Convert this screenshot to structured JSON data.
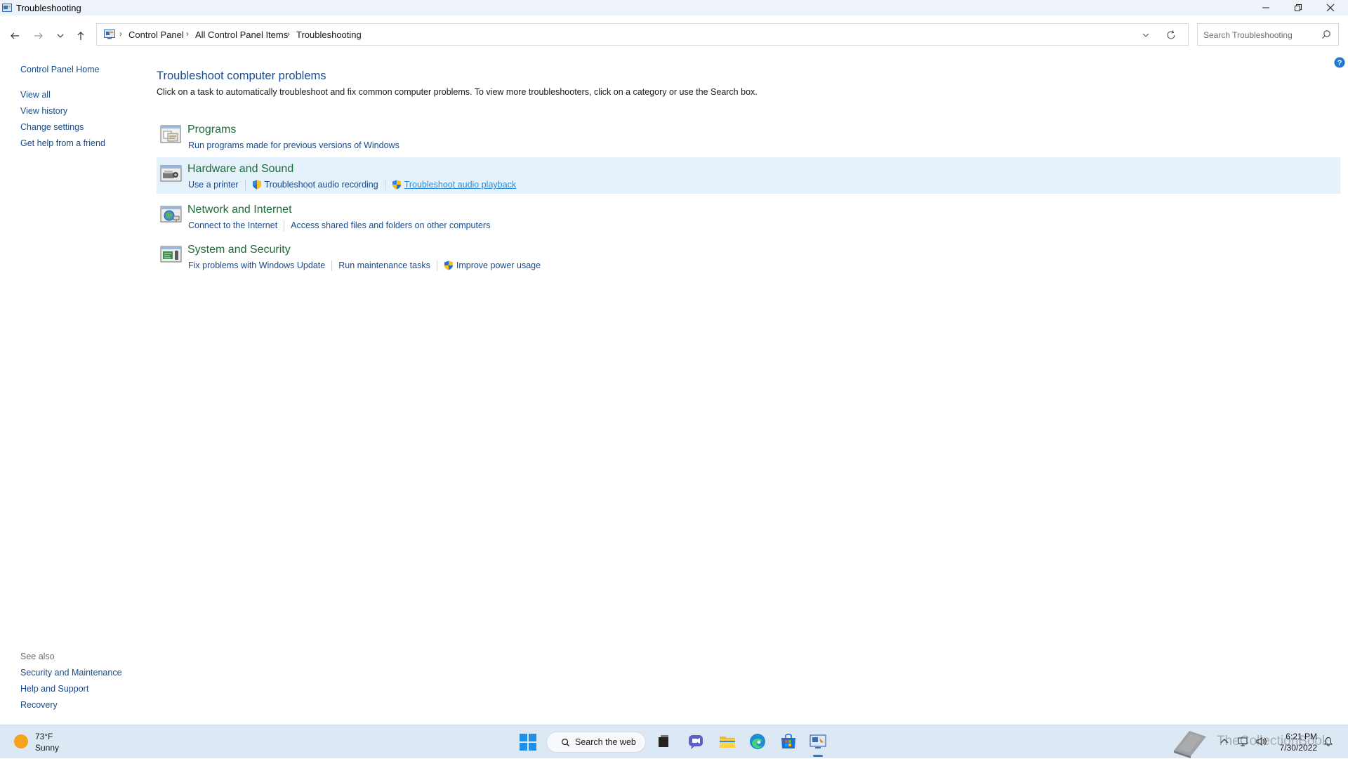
{
  "window": {
    "title": "Troubleshooting"
  },
  "breadcrumb": [
    "Control Panel",
    "All Control Panel Items",
    "Troubleshooting"
  ],
  "search": {
    "placeholder": "Search Troubleshooting"
  },
  "sidebar": {
    "home": "Control Panel Home",
    "items": [
      "View all",
      "View history",
      "Change settings",
      "Get help from a friend"
    ],
    "see_also_label": "See also",
    "see_also": [
      "Security and Maintenance",
      "Help and Support",
      "Recovery"
    ]
  },
  "main": {
    "title": "Troubleshoot computer problems",
    "description": "Click on a task to automatically troubleshoot and fix common computer problems. To view more troubleshooters, click on a category or use the Search box.",
    "categories": [
      {
        "title": "Programs",
        "icon": "programs-icon",
        "links": [
          {
            "label": "Run programs made for previous versions of Windows",
            "shield": false
          }
        ]
      },
      {
        "title": "Hardware and Sound",
        "icon": "hardware-sound-icon",
        "links": [
          {
            "label": "Use a printer",
            "shield": false
          },
          {
            "label": "Troubleshoot audio recording",
            "shield": true
          },
          {
            "label": "Troubleshoot audio playback",
            "shield": true
          }
        ]
      },
      {
        "title": "Network and Internet",
        "icon": "network-icon",
        "links": [
          {
            "label": "Connect to the Internet",
            "shield": false
          },
          {
            "label": "Access shared files and folders on other computers",
            "shield": false
          }
        ]
      },
      {
        "title": "System and Security",
        "icon": "system-security-icon",
        "links": [
          {
            "label": "Fix problems with Windows Update",
            "shield": false
          },
          {
            "label": "Run maintenance tasks",
            "shield": false
          },
          {
            "label": "Improve power usage",
            "shield": true
          }
        ]
      }
    ]
  },
  "taskbar": {
    "weather": {
      "temp": "73°F",
      "condition": "Sunny"
    },
    "search_label": "Search the web",
    "watermark": "TheCollectionBook",
    "time": "6:21 PM",
    "date": "7/30/2022"
  },
  "colors": {
    "link": "#1a4a8a",
    "category_title": "#1f6b3a",
    "highlight_row": "#e5f1fb",
    "taskbar": "#dde8f5",
    "accent": "#2b79d0"
  }
}
